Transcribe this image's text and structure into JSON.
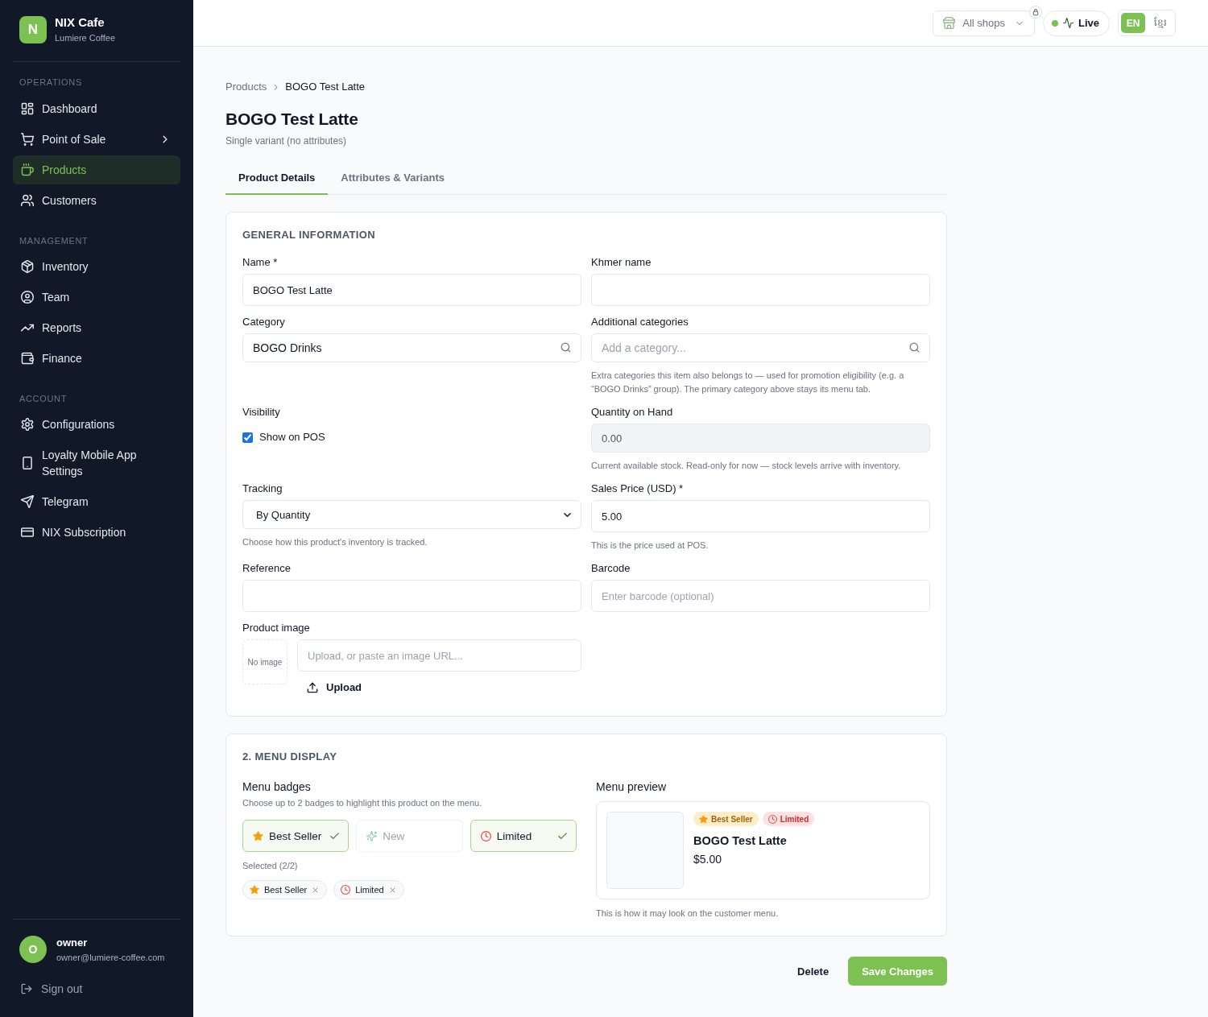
{
  "sidebar": {
    "brand": {
      "logo": "N",
      "name": "NIX Cafe",
      "subtitle": "Lumiere Coffee"
    },
    "sections": [
      {
        "title": "OPERATIONS",
        "items": [
          {
            "label": "Dashboard",
            "selected": false,
            "expandable": false
          },
          {
            "label": "Point of Sale",
            "selected": false,
            "expandable": true
          },
          {
            "label": "Products",
            "selected": true,
            "expandable": false
          },
          {
            "label": "Customers",
            "selected": false,
            "expandable": false
          }
        ]
      },
      {
        "title": "MANAGEMENT",
        "items": [
          {
            "label": "Inventory",
            "selected": false,
            "expandable": false
          },
          {
            "label": "Team",
            "selected": false,
            "expandable": false
          },
          {
            "label": "Reports",
            "selected": false,
            "expandable": false
          },
          {
            "label": "Finance",
            "selected": false,
            "expandable": false
          }
        ]
      },
      {
        "title": "ACCOUNT",
        "items": [
          {
            "label": "Configurations",
            "selected": false,
            "expandable": false
          },
          {
            "label": "Loyalty Mobile App Settings",
            "selected": false,
            "expandable": false
          },
          {
            "label": "Telegram",
            "selected": false,
            "expandable": false
          },
          {
            "label": "NIX Subscription",
            "selected": false,
            "expandable": false
          }
        ]
      }
    ],
    "user": {
      "avatar": "O",
      "name": "owner",
      "email": "owner@lumiere-coffee.com"
    },
    "sign_out": "Sign out"
  },
  "topbar": {
    "shop_selector": {
      "label": "All shops",
      "locked": true
    },
    "live_status": {
      "label": "Live",
      "on": true
    },
    "languages": [
      {
        "label": "EN",
        "selected": true
      },
      {
        "label": "ខ្មែរ",
        "selected": false
      }
    ]
  },
  "breadcrumb": [
    "Products",
    "BOGO Test Latte"
  ],
  "page": {
    "title": "BOGO Test Latte",
    "subtitle": "Single variant (no attributes)"
  },
  "tabs": [
    {
      "label": "Product Details",
      "selected": true
    },
    {
      "label": "Attributes & Variants",
      "selected": false
    }
  ],
  "general_information": {
    "title": "GENERAL INFORMATION",
    "fields": [
      {
        "kind": "text",
        "label": "Name *",
        "value": "BOGO Test Latte",
        "disabled": false
      },
      {
        "kind": "text",
        "label": "Khmer name",
        "disabled": false
      },
      {
        "kind": "search",
        "label": "Category",
        "value": "BOGO Drinks",
        "disabled": false
      },
      {
        "kind": "search",
        "label": "Additional categories",
        "placeholder": "Add a category...",
        "help": "Extra categories this item also belongs to — used for promotion eligibility (e.g. a “BOGO Drinks” group). The primary category above stays its menu tab.",
        "disabled": false
      },
      {
        "kind": "checkbox",
        "label": "Visibility",
        "option": "Show on POS",
        "checked": true,
        "disabled": false
      },
      {
        "kind": "text",
        "label": "Quantity on Hand",
        "value": "0.00",
        "help": "Current available stock. Read-only for now — stock levels arrive with inventory.",
        "disabled": true
      },
      {
        "kind": "select",
        "label": "Tracking",
        "value": "By Quantity",
        "help": "Choose how this product's inventory is tracked.",
        "disabled": false
      },
      {
        "kind": "text",
        "label": "Sales Price (USD) *",
        "value": "5.00",
        "help": "This is the price used at POS.",
        "disabled": false
      },
      {
        "kind": "text",
        "label": "Reference",
        "disabled": false
      },
      {
        "kind": "text",
        "label": "Barcode",
        "placeholder": "Enter barcode (optional)",
        "disabled": false
      },
      {
        "kind": "image",
        "label": "Product image",
        "thumbnail": "No image",
        "placeholder": "Upload, or paste an image URL...",
        "button": "Upload",
        "disabled": false
      }
    ]
  },
  "menu_display": {
    "title": "2. MENU DISPLAY",
    "badges_label": "Menu badges",
    "badges_help": "Choose up to 2 badges to highlight this product on the menu.",
    "badges": [
      {
        "kind": "bestseller",
        "label": "Best Seller",
        "selected": true
      },
      {
        "kind": "new",
        "label": "New",
        "selected": false
      },
      {
        "kind": "limited",
        "label": "Limited",
        "selected": true
      }
    ],
    "selected_count": "Selected (2/2)",
    "selected_chips": [
      {
        "kind": "bestseller",
        "label": "Best Seller"
      },
      {
        "kind": "limited",
        "label": "Limited"
      }
    ],
    "preview_label": "Menu preview",
    "preview": {
      "tags": [
        {
          "kind": "bestseller",
          "label": "Best Seller"
        },
        {
          "kind": "limited",
          "label": "Limited"
        }
      ],
      "name": "BOGO Test Latte",
      "price": "$5.00"
    },
    "preview_caption": "This is how it may look on the customer menu."
  },
  "actions": {
    "delete": "Delete",
    "save": "Save Changes"
  }
}
